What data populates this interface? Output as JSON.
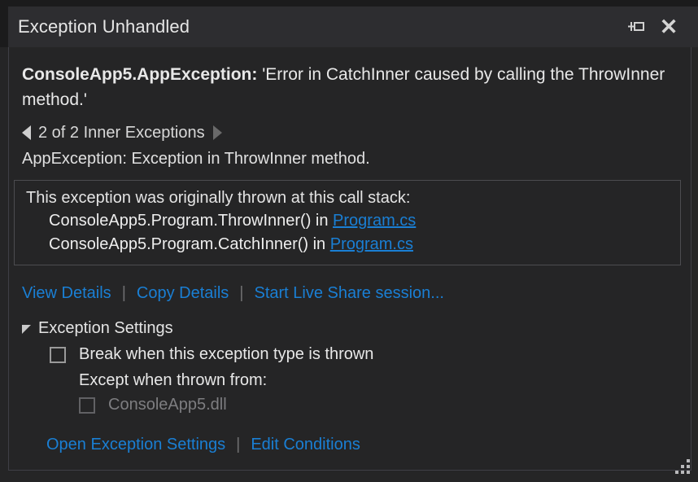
{
  "window": {
    "title": "Exception Unhandled",
    "pin_icon": "pin-icon",
    "close_icon": "close-icon",
    "close_glyph": "✕"
  },
  "exception": {
    "type": "ConsoleApp5.AppException:",
    "message": "'Error in CatchInner caused by calling the ThrowInner method.'"
  },
  "inner": {
    "prev_icon": "previous-inner-exception-arrow",
    "next_icon": "next-inner-exception-arrow",
    "label": "2 of 2 Inner Exceptions",
    "description": "AppException: Exception in ThrowInner method."
  },
  "callstack": {
    "header": "This exception was originally thrown at this call stack:",
    "frames": [
      {
        "method": "ConsoleApp5.Program.ThrowInner() in ",
        "link": "Program.cs"
      },
      {
        "method": "ConsoleApp5.Program.CatchInner() in ",
        "link": "Program.cs"
      }
    ]
  },
  "actions": {
    "view_details": "View Details",
    "copy_details": "Copy Details",
    "live_share": "Start Live Share session...",
    "separator": "|"
  },
  "settings": {
    "expander_icon": "expander-expanded-icon",
    "title": "Exception Settings",
    "break_checkbox_label": "Break when this exception type is thrown",
    "break_checked": false,
    "except_when_label": "Except when thrown from:",
    "module_label": "ConsoleApp5.dll",
    "module_checked": false,
    "module_disabled": true
  },
  "footer": {
    "open_settings": "Open Exception Settings",
    "edit_conditions": "Edit Conditions",
    "separator": "|"
  },
  "resize": {
    "grip_icon": "resize-grip-icon"
  },
  "colors": {
    "dialog_bg": "#252526",
    "titlebar_bg": "#2d2d30",
    "outer_bg": "#1b1b1c",
    "link_blue": "#1a7fd4",
    "text": "#e8e8e8",
    "disabled_text": "#7d7d80",
    "border": "#3f3f46"
  }
}
